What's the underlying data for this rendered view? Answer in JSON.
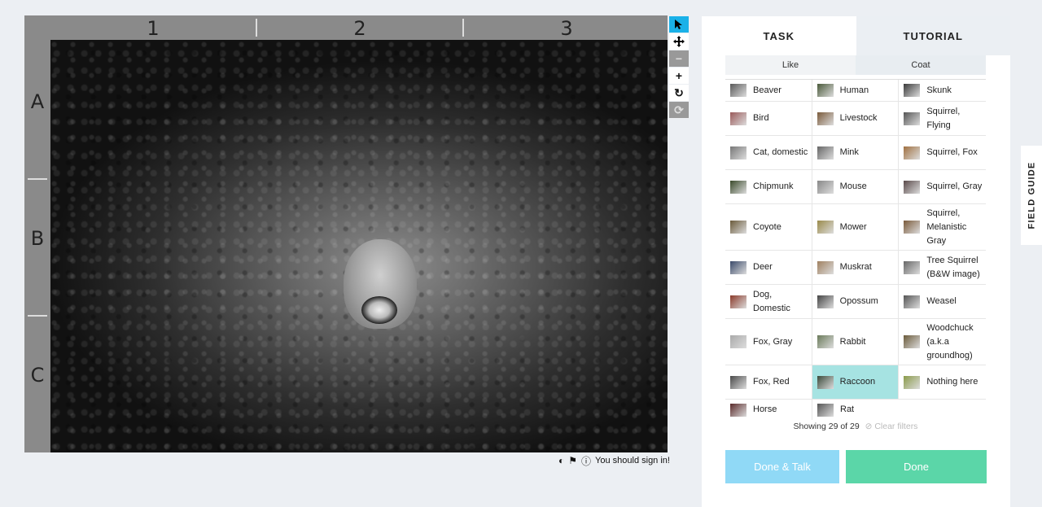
{
  "viewer": {
    "columns": [
      "1",
      "2",
      "3"
    ],
    "rows": [
      "A",
      "B",
      "C"
    ]
  },
  "toolbar": {
    "select_icon": "arrow-pointer-icon",
    "move_icon": "move-arrows-icon",
    "zoom_out": "−",
    "zoom_in": "+",
    "rotate": "↻",
    "reset": "⟳"
  },
  "meta_bar": {
    "contrast_icon": "◐",
    "flag_icon": "⚑",
    "info_icon": "ⓘ",
    "signin_text": "You should sign in!"
  },
  "tabs": [
    "TASK",
    "TUTORIAL"
  ],
  "filters": [
    "Like",
    "Coat"
  ],
  "species": [
    [
      {
        "label": "Beaver",
        "color": "#5a5a5a"
      },
      {
        "label": "Human",
        "color": "#4a5a3a"
      },
      {
        "label": "Skunk",
        "color": "#3a3a3a"
      }
    ],
    [
      {
        "label": "Bird",
        "color": "#9a5a5a"
      },
      {
        "label": "Livestock",
        "color": "#7a5a3a"
      },
      {
        "label": "Squirrel, Flying",
        "color": "#555"
      }
    ],
    [
      {
        "label": "Cat, domestic",
        "color": "#777"
      },
      {
        "label": "Mink",
        "color": "#666"
      },
      {
        "label": "Squirrel, Fox",
        "color": "#a07040"
      }
    ],
    [
      {
        "label": "Chipmunk",
        "color": "#3a4a2a"
      },
      {
        "label": "Mouse",
        "color": "#888"
      },
      {
        "label": "Squirrel, Gray",
        "color": "#5a4a4a"
      }
    ],
    [
      {
        "label": "Coyote",
        "color": "#6a5a3a"
      },
      {
        "label": "Mower",
        "color": "#9a8a4a"
      },
      {
        "label": "Squirrel, Melanistic Gray",
        "color": "#7a5a3a"
      }
    ],
    [
      {
        "label": "Deer",
        "color": "#3a4a6a"
      },
      {
        "label": "Muskrat",
        "color": "#a08060"
      },
      {
        "label": "Tree Squirrel (B&W image)",
        "color": "#666"
      }
    ],
    [
      {
        "label": "Dog, Domestic",
        "color": "#8a3a2a"
      },
      {
        "label": "Opossum",
        "color": "#444"
      },
      {
        "label": "Weasel",
        "color": "#555"
      }
    ],
    [
      {
        "label": "Fox, Gray",
        "color": "#aaa"
      },
      {
        "label": "Rabbit",
        "color": "#6a7a5a"
      },
      {
        "label": "Woodchuck (a.k.a groundhog)",
        "color": "#6a5a3a"
      }
    ],
    [
      {
        "label": "Fox, Red",
        "color": "#4a4a4a"
      },
      {
        "label": "Raccoon",
        "color": "#3a4a3a",
        "selected": true
      },
      {
        "label": "Nothing here",
        "color": "#8a9a4a"
      }
    ],
    [
      {
        "label": "Horse",
        "color": "#5a2a2a"
      },
      {
        "label": "Rat",
        "color": "#555"
      }
    ]
  ],
  "showing_text": "Showing 29 of 29",
  "clear_filters": "⊘ Clear filters",
  "buttons": {
    "done_talk": "Done & Talk",
    "done": "Done"
  },
  "field_guide": "FIELD GUIDE"
}
